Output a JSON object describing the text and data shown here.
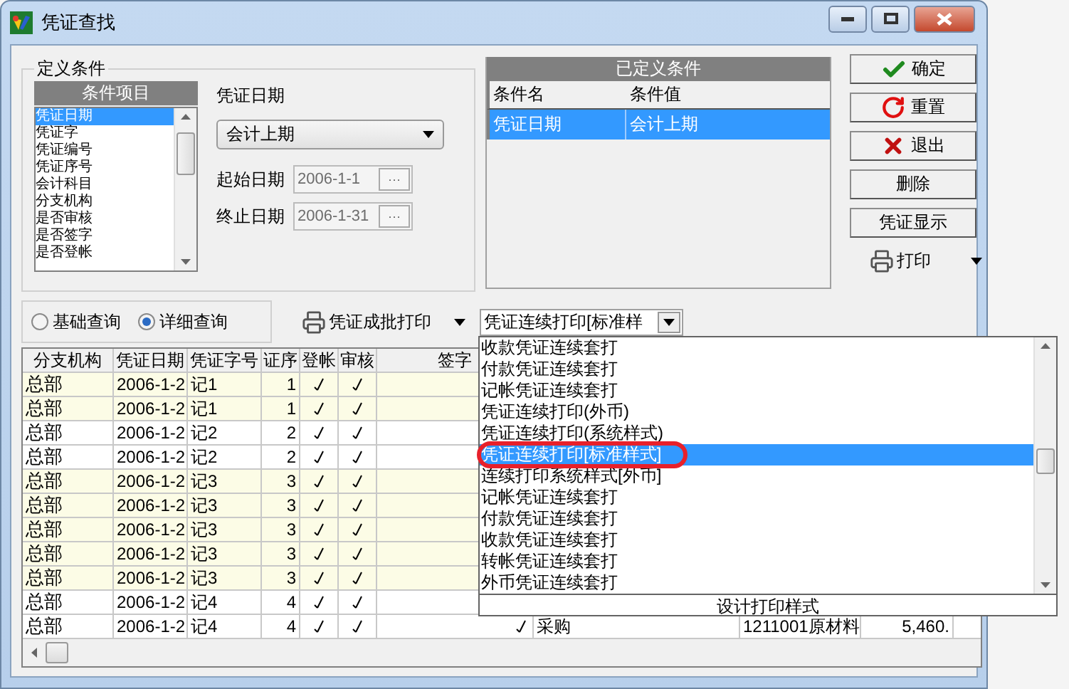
{
  "window": {
    "title": "凭证查找"
  },
  "conditions": {
    "title": "定义条件",
    "list_header": "条件项目",
    "items": [
      {
        "label": "凭证日期",
        "selected": true
      },
      {
        "label": "凭证字",
        "selected": false
      },
      {
        "label": "凭证编号",
        "selected": false
      },
      {
        "label": "凭证序号",
        "selected": false
      },
      {
        "label": "会计科目",
        "selected": false
      },
      {
        "label": "分支机构",
        "selected": false
      },
      {
        "label": "是否审核",
        "selected": false
      },
      {
        "label": "是否签字",
        "selected": false
      },
      {
        "label": "是否登帐",
        "selected": false
      }
    ],
    "field_label": "凭证日期",
    "period": "会计上期",
    "dates": [
      {
        "label": "起始日期",
        "value": "2006-1-1",
        "button": "···",
        "disabled": true
      },
      {
        "label": "终止日期",
        "value": "2006-1-31",
        "button": "···",
        "disabled": true
      }
    ]
  },
  "defined": {
    "title": "已定义条件",
    "columns": [
      "条件名",
      "条件值"
    ],
    "rows": [
      {
        "name": "凭证日期",
        "value": "会计上期",
        "selected": true
      }
    ]
  },
  "buttons": [
    {
      "label": "确定",
      "kind": "confirm"
    },
    {
      "label": "重置",
      "kind": "reset"
    },
    {
      "label": "退出",
      "kind": "exit"
    },
    {
      "label": "删除",
      "kind": "plain"
    },
    {
      "label": "凭证显示",
      "kind": "plain"
    },
    {
      "label": "打印",
      "kind": "menu"
    }
  ],
  "mode": [
    {
      "label": "基础查询",
      "selected": false
    },
    {
      "label": "详细查询",
      "selected": true
    }
  ],
  "batch_print": {
    "label": "凭证成批打印"
  },
  "style_select": {
    "value": "凭证连续打印[标准样"
  },
  "dropdown": {
    "items": [
      {
        "label": "收款凭证连续套打",
        "selected": false,
        "circled": false
      },
      {
        "label": "付款凭证连续套打",
        "selected": false,
        "circled": false
      },
      {
        "label": "记帐凭证连续套打",
        "selected": false,
        "circled": false
      },
      {
        "label": "凭证连续打印(外币)",
        "selected": false,
        "circled": false
      },
      {
        "label": "凭证连续打印(系统样式)",
        "selected": false,
        "circled": false
      },
      {
        "label": "凭证连续打印[标准样式]",
        "selected": true,
        "circled": true
      },
      {
        "label": "连续打印系统样式[外币]",
        "selected": false,
        "circled": false
      },
      {
        "label": "记帐凭证连续套打",
        "selected": false,
        "circled": false
      },
      {
        "label": "付款凭证连续套打",
        "selected": false,
        "circled": false
      },
      {
        "label": "收款凭证连续套打",
        "selected": false,
        "circled": false
      },
      {
        "label": "转帐凭证连续套打",
        "selected": false,
        "circled": false
      },
      {
        "label": "外币凭证连续套打",
        "selected": false,
        "circled": false
      }
    ],
    "footer": "设计打印样式"
  },
  "grid": {
    "columns": [
      "分支机构",
      "凭证日期",
      "凭证字号",
      "证序",
      "登帐",
      "审核",
      "签字"
    ],
    "rows": [
      {
        "cells": [
          "总部",
          "2006-1-2",
          "记1",
          "1"
        ],
        "posted": true,
        "audited": true,
        "shaded": true
      },
      {
        "cells": [
          "总部",
          "2006-1-2",
          "记1",
          "1"
        ],
        "posted": true,
        "audited": true,
        "shaded": true
      },
      {
        "cells": [
          "总部",
          "2006-1-2",
          "记2",
          "2"
        ],
        "posted": true,
        "audited": true,
        "shaded": false
      },
      {
        "cells": [
          "总部",
          "2006-1-2",
          "记2",
          "2"
        ],
        "posted": true,
        "audited": true,
        "shaded": false
      },
      {
        "cells": [
          "总部",
          "2006-1-2",
          "记3",
          "3"
        ],
        "posted": true,
        "audited": true,
        "shaded": true
      },
      {
        "cells": [
          "总部",
          "2006-1-2",
          "记3",
          "3"
        ],
        "posted": true,
        "audited": true,
        "shaded": true
      },
      {
        "cells": [
          "总部",
          "2006-1-2",
          "记3",
          "3"
        ],
        "posted": true,
        "audited": true,
        "shaded": true
      },
      {
        "cells": [
          "总部",
          "2006-1-2",
          "记3",
          "3"
        ],
        "posted": true,
        "audited": true,
        "shaded": true
      },
      {
        "cells": [
          "总部",
          "2006-1-2",
          "记3",
          "3"
        ],
        "posted": true,
        "audited": true,
        "shaded": true
      },
      {
        "cells": [
          "总部",
          "2006-1-2",
          "记4",
          "4"
        ],
        "posted": true,
        "audited": true,
        "shaded": false
      },
      {
        "cells": [
          "总部",
          "2006-1-2",
          "记4",
          "4"
        ],
        "posted": true,
        "audited": true,
        "signed": true,
        "shaded": false,
        "tail": [
          "采购",
          "1211001原材料",
          "5,460."
        ]
      }
    ]
  }
}
